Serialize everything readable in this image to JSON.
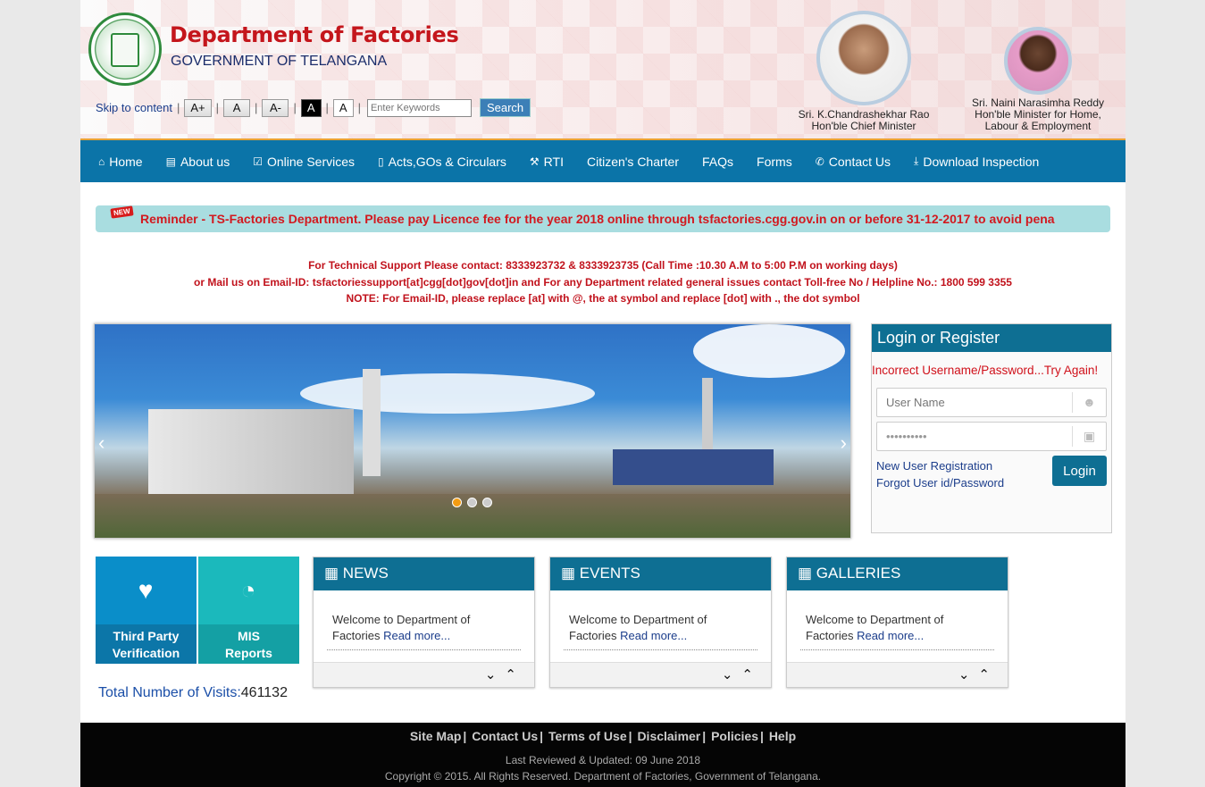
{
  "header": {
    "title": "Department of Factories",
    "subtitle": "GOVERNMENT OF TELANGANA",
    "skip_link": "Skip to content",
    "font_buttons": [
      "A+",
      "A",
      "A-",
      "A",
      "A"
    ],
    "search_placeholder": "Enter Keywords",
    "search_label": "Search"
  },
  "ministers": [
    {
      "name": "Sri. K.Chandrashekhar Rao",
      "role": "Hon'ble Chief Minister"
    },
    {
      "name": "Sri. Naini Narasimha Reddy",
      "role": "Hon'ble Minister for Home,",
      "role2": "Labour & Employment"
    }
  ],
  "nav": {
    "items": [
      {
        "icon": "⌂",
        "label": "Home"
      },
      {
        "icon": "▤",
        "label": "About us"
      },
      {
        "icon": "☑",
        "label": "Online Services"
      },
      {
        "icon": "▯",
        "label": "Acts,GOs & Circulars"
      },
      {
        "icon": "⚒",
        "label": "RTI"
      },
      {
        "icon": "",
        "label": "Citizen's Charter"
      },
      {
        "icon": "",
        "label": "FAQs"
      },
      {
        "icon": "",
        "label": "Forms"
      },
      {
        "icon": "✆",
        "label": "Contact Us"
      },
      {
        "icon": "⤓",
        "label": "Download Inspection"
      }
    ]
  },
  "ticker": {
    "badge": "NEW",
    "text": "Reminder - TS-Factories Department. Please pay Licence fee for the year 2018 online through tsfactories.cgg.gov.in on or before 31-12-2017 to avoid pena"
  },
  "support": {
    "line1": "For Technical Support Please contact: 8333923732 & 8333923735 (Call Time :10.30 A.M to 5:00 P.M on working days)",
    "line2": "or Mail us on Email-ID: tsfactoriessupport[at]cgg[dot]gov[dot]in and For any Department related general issues contact Toll-free No / Helpline No.: 1800 599 3355",
    "line3": "NOTE: For Email-ID, please replace [at] with @, the at symbol and replace [dot] with ., the dot symbol"
  },
  "slider": {
    "prev": "‹",
    "next": "›"
  },
  "login": {
    "heading": "Login or Register",
    "error": "Incorrect Username/Password...Try Again!",
    "username_placeholder": "User Name",
    "password_value": "••••••••••",
    "new_user": "New User Registration",
    "forgot": "Forgot User id/Password",
    "button": "Login"
  },
  "tiles": [
    {
      "line1": "Third Party",
      "line2": "Verification",
      "color": "#0a8ec9"
    },
    {
      "line1": "MIS",
      "line2": "Reports",
      "color": "#1bb9bc"
    }
  ],
  "visits": {
    "label": "Total Number of Visits:",
    "count": "461132"
  },
  "panels": [
    {
      "title": "NEWS",
      "text": "Welcome to Department of Factories ",
      "link": "Read more..."
    },
    {
      "title": "EVENTS",
      "text": "Welcome to Department of Factories ",
      "link": "Read more..."
    },
    {
      "title": "GALLERIES",
      "text": "Welcome to Department of Factories ",
      "link": "Read more..."
    }
  ],
  "footer": {
    "links": [
      "Site Map",
      "Contact Us",
      "Terms of Use",
      "Disclaimer",
      "Policies",
      "Help"
    ],
    "updated": "Last Reviewed & Updated: 09 June 2018",
    "copyright": "Copyright © 2015. All Rights Reserved. Department of Factories, Government of Telangana."
  },
  "colors": {
    "nav": "#0b74a8",
    "title_red": "#c4161c",
    "panel_header": "#0e6f93"
  }
}
